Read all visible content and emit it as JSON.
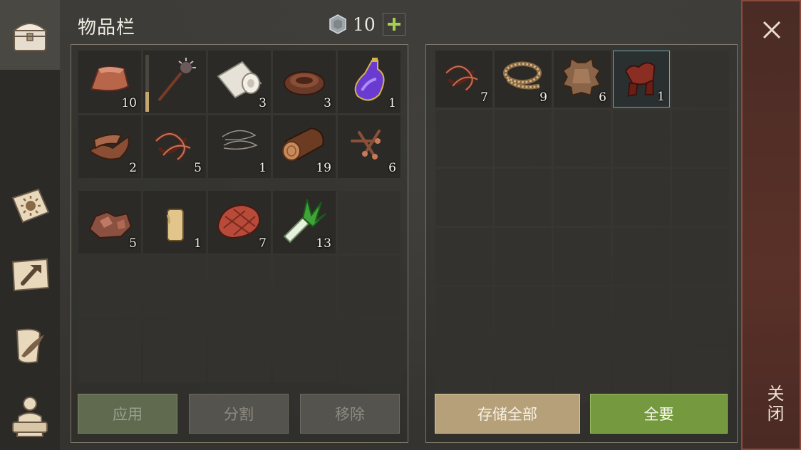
{
  "header": {
    "title": "物品栏",
    "currency_amount": "10",
    "add_icon": "plus-icon"
  },
  "sidebar": {
    "tabs": [
      {
        "name": "inventory-chest",
        "icon": "chest-icon",
        "active": true
      },
      {
        "name": "skills",
        "icon": "sun-scroll-icon",
        "active": false
      },
      {
        "name": "crafting",
        "icon": "hammer-map-icon",
        "active": false
      },
      {
        "name": "quests",
        "icon": "quill-scroll-icon",
        "active": false
      },
      {
        "name": "character",
        "icon": "character-silhouette-icon",
        "active": false
      }
    ]
  },
  "inventory": {
    "top_grid": [
      {
        "icon": "copper-ingot-icon",
        "qty": "10"
      },
      {
        "icon": "spiked-mace-icon",
        "qty": "",
        "durability": 0.35
      },
      {
        "icon": "cloth-roll-icon",
        "qty": "3"
      },
      {
        "icon": "leather-strap-icon",
        "qty": "3"
      },
      {
        "icon": "purple-potion-icon",
        "qty": "1"
      },
      {
        "icon": "leather-scraps-icon",
        "qty": "2"
      },
      {
        "icon": "leather-straps-icon",
        "qty": "5"
      },
      {
        "icon": "wire-coil-icon",
        "qty": "1"
      },
      {
        "icon": "log-icon",
        "qty": "19"
      },
      {
        "icon": "nails-icon",
        "qty": "6"
      }
    ],
    "bottom_grid": [
      {
        "icon": "copper-ore-icon",
        "qty": "5"
      },
      {
        "icon": "candle-icon",
        "qty": "1"
      },
      {
        "icon": "raw-meat-icon",
        "qty": "7"
      },
      {
        "icon": "leek-icon",
        "qty": "13"
      },
      null,
      null,
      null,
      null,
      null,
      null,
      null,
      null,
      null,
      null,
      null
    ]
  },
  "storage": {
    "grid": [
      {
        "icon": "leather-straps-icon",
        "qty": "7"
      },
      {
        "icon": "rope-icon",
        "qty": "9"
      },
      {
        "icon": "animal-hide-icon",
        "qty": "6"
      },
      {
        "icon": "saddle-icon",
        "qty": "1",
        "selected": true
      },
      null,
      null,
      null,
      null,
      null,
      null,
      null,
      null,
      null,
      null,
      null,
      null,
      null,
      null,
      null,
      null,
      null,
      null,
      null,
      null,
      null,
      null,
      null,
      null,
      null,
      null
    ]
  },
  "buttons": {
    "apply": "应用",
    "split": "分割",
    "remove": "移除",
    "store_all": "存储全部",
    "take_all": "全要"
  },
  "close": {
    "label": "关闭"
  },
  "colors": {
    "accent_green": "#75993e",
    "tan": "#b5a079",
    "close_red": "#5a3128",
    "selected_border": "#6fa6b5"
  }
}
